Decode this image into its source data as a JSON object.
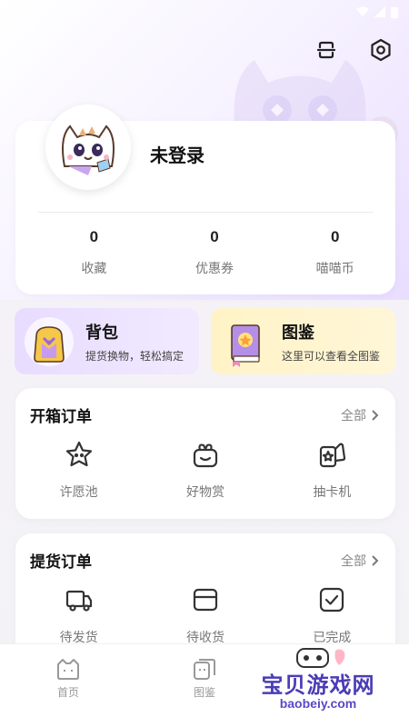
{
  "status_bar": {
    "time": ""
  },
  "icons": {
    "scan": "scan-icon",
    "settings": "gear-icon"
  },
  "profile": {
    "username": "未登录",
    "stats": [
      {
        "value": "0",
        "label": "收藏"
      },
      {
        "value": "0",
        "label": "优惠券"
      },
      {
        "value": "0",
        "label": "喵喵币"
      }
    ]
  },
  "features": {
    "bag": {
      "title": "背包",
      "subtitle": "提货换物，轻松搞定"
    },
    "atlas": {
      "title": "图鉴",
      "subtitle": "这里可以查看全图鉴"
    }
  },
  "open_orders": {
    "title": "开箱订单",
    "all": "全部",
    "items": [
      {
        "label": "许愿池"
      },
      {
        "label": "好物赏"
      },
      {
        "label": "抽卡机"
      }
    ]
  },
  "pickup_orders": {
    "title": "提货订单",
    "all": "全部",
    "items": [
      {
        "label": "待发货"
      },
      {
        "label": "待收货"
      },
      {
        "label": "已完成"
      }
    ]
  },
  "tabbar": {
    "items": [
      {
        "label": "首页"
      },
      {
        "label": "图鉴"
      },
      {
        "label": ""
      }
    ]
  },
  "watermark": {
    "text": "宝贝游戏网",
    "url": "baobeiy.com"
  },
  "colors": {
    "accent": "#6a4fd8",
    "bag_bg": "#e8dcff",
    "atlas_bg": "#fff3c6"
  }
}
